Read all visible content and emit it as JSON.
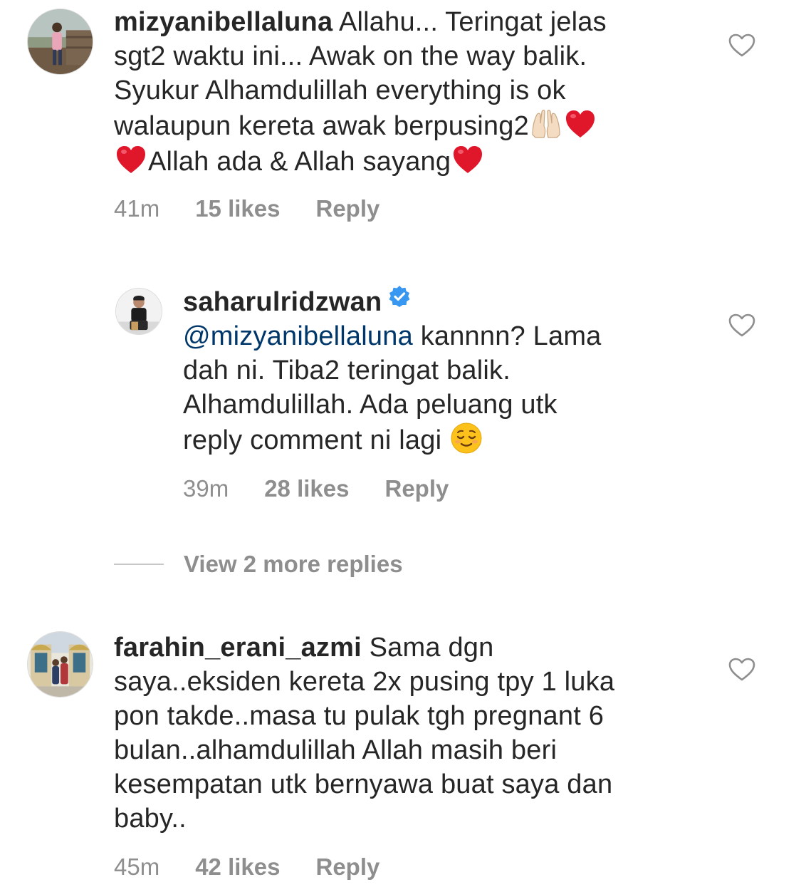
{
  "comments": [
    {
      "username": "mizyanibellaluna",
      "text_lines": [
        "Allahu... Teringat jelas",
        "sgt2 waktu ini... Awak on the way balik.",
        "Syukur Alhamdulillah everything is ok",
        "walaupun kereta awak berpusing2",
        "Allah ada & Allah sayang"
      ],
      "time": "41m",
      "likes": "15 likes",
      "reply": "Reply"
    },
    {
      "username": "saharulridzwan",
      "verified": true,
      "mention": "@mizyanibellaluna",
      "text_lines": [
        "kannnn? Lama",
        "dah ni. Tiba2 teringat balik.",
        "Alhamdulillah. Ada peluang utk",
        "reply comment ni lagi"
      ],
      "time": "39m",
      "likes": "28 likes",
      "reply": "Reply"
    },
    {
      "username": "farahin_erani_azmi",
      "text_lines": [
        "Sama dgn",
        "saya..eksiden kereta 2x pusing tpy 1 luka",
        "pon takde..masa tu pulak tgh pregnant 6",
        "bulan..alhamdulillah Allah masih beri",
        "kesempatan utk bernyawa buat saya dan",
        "baby.."
      ],
      "time": "45m",
      "likes": "42 likes",
      "reply": "Reply"
    }
  ],
  "view_more_replies": "View 2 more replies",
  "icons": {
    "like": "heart-outline-icon",
    "verified": "verified-badge-icon",
    "emoji_hands": "raised-hands-emoji",
    "emoji_heart": "red-heart-emoji",
    "emoji_relieved": "relieved-face-emoji"
  },
  "colors": {
    "text": "#262626",
    "meta": "#8e8e8e",
    "mention": "#00376b",
    "verified": "#3897f0",
    "heart_emoji": "#e0162b"
  }
}
